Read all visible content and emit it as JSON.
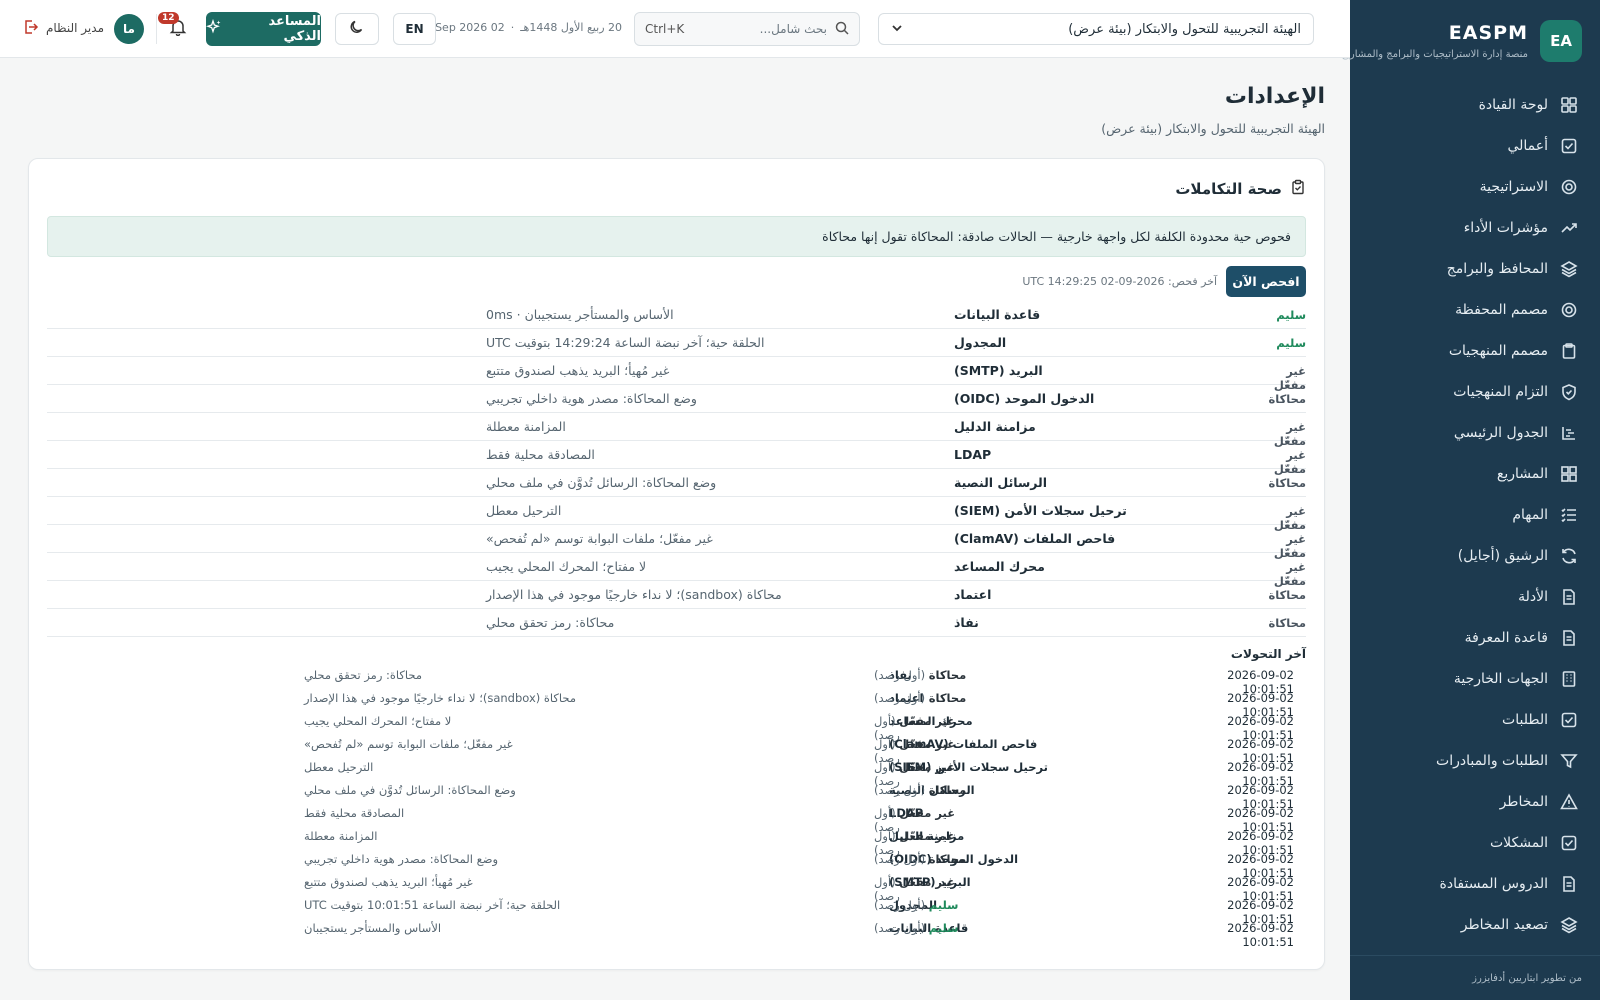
{
  "brand": {
    "badge": "EA",
    "name": "EASPM",
    "subtitle": "منصة إدارة الاستراتيجيات والبرامج والمشاريع"
  },
  "sidebar": {
    "items": [
      {
        "label": "لوحة القيادة",
        "icon": "dashboard-icon"
      },
      {
        "label": "أعمالي",
        "icon": "checkbox-icon"
      },
      {
        "label": "الاستراتيجية",
        "icon": "target-icon"
      },
      {
        "label": "مؤشرات الأداء",
        "icon": "trend-icon"
      },
      {
        "label": "المحافظ والبرامج",
        "icon": "layers-icon"
      },
      {
        "label": "مصمم المحفظة",
        "icon": "target-icon"
      },
      {
        "label": "مصمم المنهجيات",
        "icon": "clipboard-icon"
      },
      {
        "label": "التزام المنهجيات",
        "icon": "shield-icon"
      },
      {
        "label": "الجدول الرئيسي",
        "icon": "gantt-icon"
      },
      {
        "label": "المشاريع",
        "icon": "grid-icon"
      },
      {
        "label": "المهام",
        "icon": "list-check-icon"
      },
      {
        "label": "الرشيق (أجايل)",
        "icon": "refresh-icon"
      },
      {
        "label": "الأدلة",
        "icon": "document-icon"
      },
      {
        "label": "قاعدة المعرفة",
        "icon": "document-icon"
      },
      {
        "label": "الجهات الخارجية",
        "icon": "building-icon"
      },
      {
        "label": "الطلبات",
        "icon": "checkbox-icon"
      },
      {
        "label": "الطلبات والمبادرات",
        "icon": "filter-icon"
      },
      {
        "label": "المخاطر",
        "icon": "warning-icon"
      },
      {
        "label": "المشكلات",
        "icon": "checkbox-icon"
      },
      {
        "label": "الدروس المستفادة",
        "icon": "document-icon"
      },
      {
        "label": "تصعيد المخاطر",
        "icon": "layers-icon"
      }
    ],
    "footer": "من تطوير ابتاريين أدفايزرز"
  },
  "topbar": {
    "org": "الهيئة التجريبية للتحول والابتكار (بيئة عرض)",
    "search_placeholder": "بحث شامل...",
    "search_shortcut": "Ctrl+K",
    "hijri_date": "20 ربيع الأول 1448هـ",
    "date_separator": "·",
    "gregorian_date": "02 Sep 2026",
    "lang": "EN",
    "assistant": "المساعد الذكي",
    "notifications": "12",
    "avatar": "ما",
    "user": "مدير النظام"
  },
  "page": {
    "title": "الإعدادات",
    "subtitle": "الهيئة التجريبية للتحول والابتكار (بيئة عرض)"
  },
  "card": {
    "title": "صحة التكاملات",
    "notice": "فحوص حية محدودة الكلفة لكل واجهة خارجية — الحالات صادقة: المحاكاة تقول إنها محاكاة",
    "check_button": "افحص الآن",
    "last_check_label": "آخر فحص:",
    "last_check_value": "2026-09-02 14:29:25 UTC",
    "checks": [
      {
        "status": "سليم",
        "kind": "healthy",
        "name": "قاعدة البيانات",
        "detail": "الأساس والمستأجر يستجيبان · 0ms"
      },
      {
        "status": "سليم",
        "kind": "healthy",
        "name": "المجدول",
        "detail": "الحلقة حية؛ آخر نبضة الساعة 14:29:24 بتوقيت UTC"
      },
      {
        "status": "غير مفعّل",
        "kind": "disabled",
        "name": "البريد (SMTP)",
        "detail": "غير مُهيأ؛ البريد يذهب لصندوق متتبع"
      },
      {
        "status": "محاكاة",
        "kind": "sim",
        "name": "الدخول الموحد (OIDC)",
        "detail": "وضع المحاكاة: مصدر هوية داخلي تجريبي"
      },
      {
        "status": "غير مفعّل",
        "kind": "disabled",
        "name": "مزامنة الدليل",
        "detail": "المزامنة معطلة"
      },
      {
        "status": "غير مفعّل",
        "kind": "disabled",
        "name": "LDAP",
        "detail": "المصادقة محلية فقط"
      },
      {
        "status": "محاكاة",
        "kind": "sim",
        "name": "الرسائل النصية",
        "detail": "وضع المحاكاة: الرسائل تُدوَّن في ملف محلي"
      },
      {
        "status": "غير مفعّل",
        "kind": "disabled",
        "name": "ترحيل سجلات الأمن (SIEM)",
        "detail": "الترحيل معطل"
      },
      {
        "status": "غير مفعّل",
        "kind": "disabled",
        "name": "فاحص الملفات (ClamAV)",
        "detail": "غير مفعّل؛ ملفات البوابة توسم «لم تُفحص»"
      },
      {
        "status": "غير مفعّل",
        "kind": "disabled",
        "name": "محرك المساعد",
        "detail": "لا مفتاح؛ المحرك المحلي يجيب"
      },
      {
        "status": "محاكاة",
        "kind": "sim",
        "name": "اعتماد",
        "detail": "محاكاة (sandbox)؛ لا نداء خارجيًا موجود في هذا الإصدار"
      },
      {
        "status": "محاكاة",
        "kind": "sim",
        "name": "نفاذ",
        "detail": "محاكاة: رمز تحقق محلي"
      }
    ],
    "transitions_title": "آخر التحولات",
    "first_seen": "(أول رصد)",
    "transitions": [
      {
        "time": "2026-09-02 10:01:51",
        "name": "نفاذ",
        "state": "محاكاة",
        "kind": "sim",
        "detail": "محاكاة: رمز تحقق محلي"
      },
      {
        "time": "2026-09-02 10:01:51",
        "name": "اعتماد",
        "state": "محاكاة",
        "kind": "sim",
        "detail": "محاكاة (sandbox)؛ لا نداء خارجيًا موجود في هذا الإصدار"
      },
      {
        "time": "2026-09-02 10:01:51",
        "name": "محرك المساعد",
        "state": "غير مفعّل",
        "kind": "disabled",
        "detail": "لا مفتاح؛ المحرك المحلي يجيب"
      },
      {
        "time": "2026-09-02 10:01:51",
        "name": "فاحص الملفات (ClamAV)",
        "state": "غير مفعّل",
        "kind": "disabled",
        "detail": "غير مفعّل؛ ملفات البوابة توسم «لم تُفحص»"
      },
      {
        "time": "2026-09-02 10:01:51",
        "name": "ترحيل سجلات الأمن (SIEM)",
        "state": "غير مفعّل",
        "kind": "disabled",
        "detail": "الترحيل معطل"
      },
      {
        "time": "2026-09-02 10:01:51",
        "name": "الرسائل النصية",
        "state": "محاكاة",
        "kind": "sim",
        "detail": "وضع المحاكاة: الرسائل تُدوَّن في ملف محلي"
      },
      {
        "time": "2026-09-02 10:01:51",
        "name": "LDAP",
        "state": "غير مفعّل",
        "kind": "disabled",
        "detail": "المصادقة محلية فقط"
      },
      {
        "time": "2026-09-02 10:01:51",
        "name": "مزامنة الدليل",
        "state": "غير مفعّل",
        "kind": "disabled",
        "detail": "المزامنة معطلة"
      },
      {
        "time": "2026-09-02 10:01:51",
        "name": "الدخول الموحد (OIDC)",
        "state": "محاكاة",
        "kind": "sim",
        "detail": "وضع المحاكاة: مصدر هوية داخلي تجريبي"
      },
      {
        "time": "2026-09-02 10:01:51",
        "name": "البريد (SMTP)",
        "state": "غير مفعّل",
        "kind": "disabled",
        "detail": "غير مُهيأ؛ البريد يذهب لصندوق متتبع"
      },
      {
        "time": "2026-09-02 10:01:51",
        "name": "المجدول",
        "state": "سليم",
        "kind": "healthy",
        "detail": "الحلقة حية؛ آخر نبضة الساعة 10:01:51 بتوقيت UTC"
      },
      {
        "time": "2026-09-02 10:01:51",
        "name": "قاعدة البيانات",
        "state": "سليم",
        "kind": "healthy",
        "detail": "الأساس والمستأجر يستجيبان"
      }
    ]
  },
  "colors": {
    "sidebar": "#1d3a4f",
    "accent": "#1d6b63",
    "healthy": "#1f8a5c",
    "primary_button": "#1e4e68"
  }
}
